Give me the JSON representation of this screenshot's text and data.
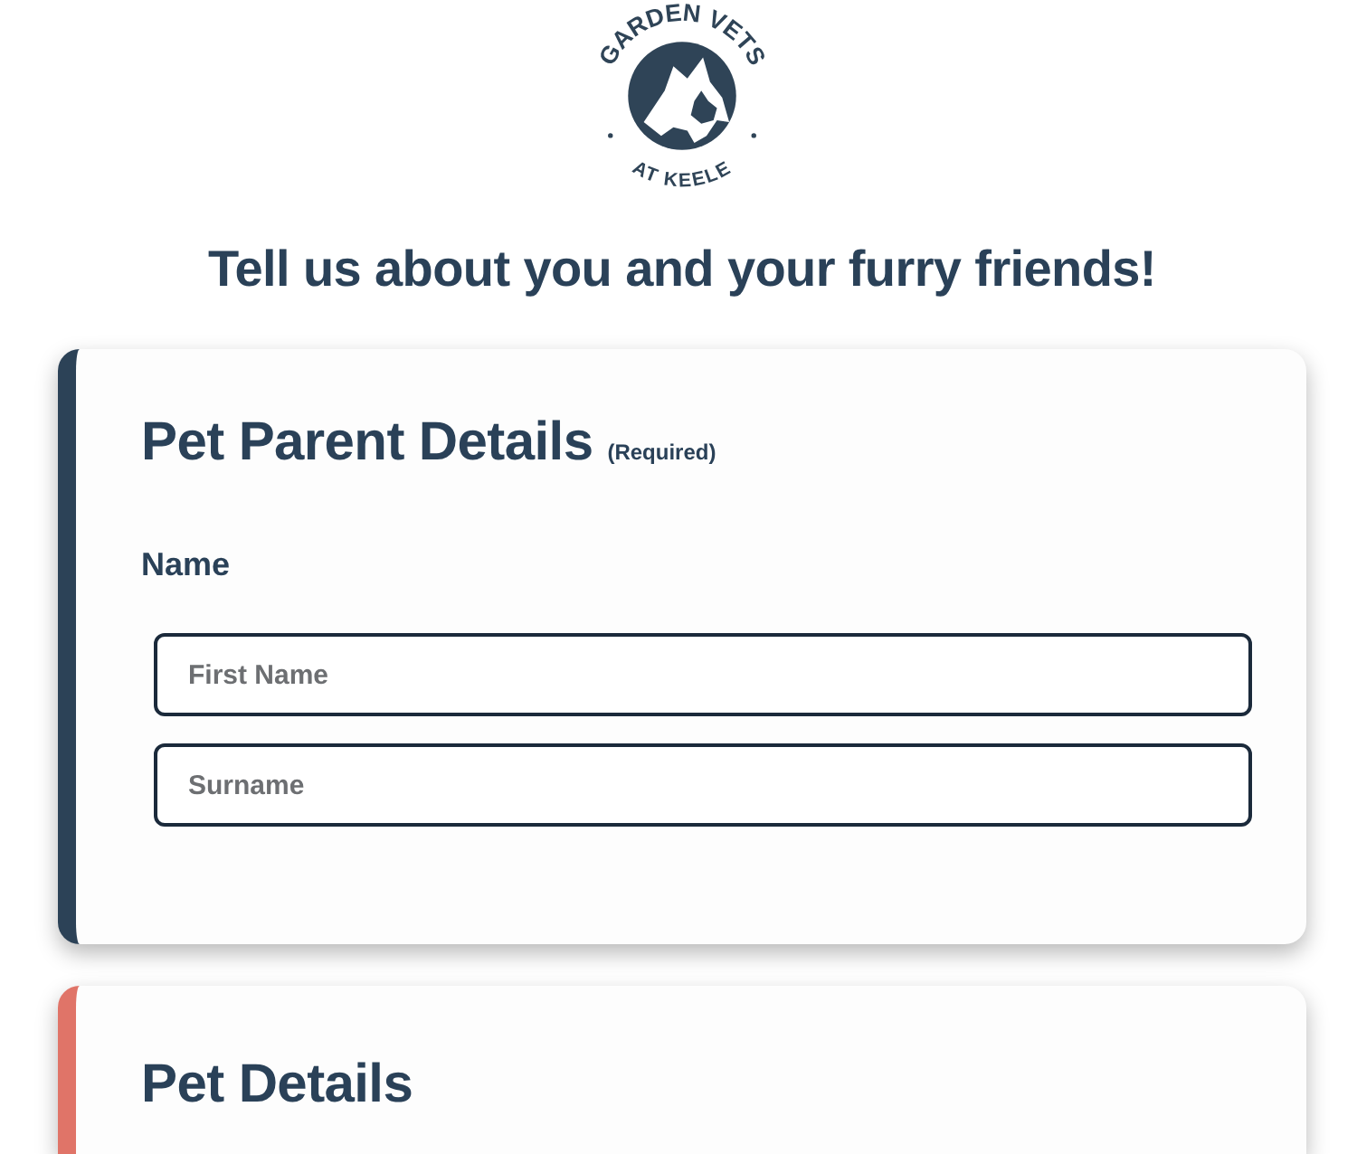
{
  "logo": {
    "top_text": "GARDEN VETS",
    "bottom_text": "AT KEELE"
  },
  "heading": "Tell us about you and your furry friends!",
  "sections": [
    {
      "title": "Pet Parent Details",
      "note": "(Required)",
      "color": "#2c4257",
      "fields": [
        {
          "label": "Name",
          "inputs": [
            {
              "placeholder": "First Name"
            },
            {
              "placeholder": "Surname"
            }
          ]
        }
      ]
    },
    {
      "title": "Pet Details",
      "color": "#e07468"
    }
  ]
}
